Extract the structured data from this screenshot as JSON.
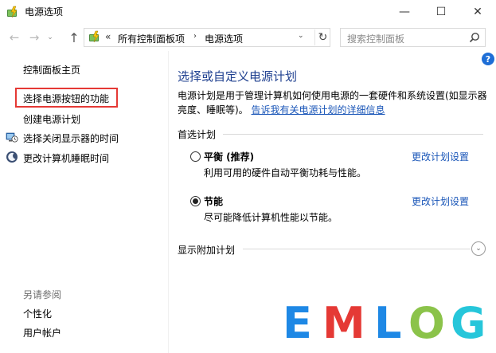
{
  "window": {
    "title": "电源选项",
    "minimize_symbol": "—",
    "maximize_symbol": "☐",
    "close_symbol": "✕"
  },
  "nav": {
    "back_symbol": "←",
    "forward_symbol": "→",
    "history_symbol": "⌄",
    "up_symbol": "↑",
    "overflow_symbol": "«",
    "breadcrumbs": [
      "所有控制面板项",
      "电源选项"
    ],
    "crumb_separator": "›",
    "address_drop_symbol": "⌄",
    "refresh_symbol": "↻",
    "search_placeholder": "搜索控制面板"
  },
  "help": {
    "label": "?"
  },
  "sidebar": {
    "home": "控制面板主页",
    "items": [
      {
        "label": "选择电源按钮的功能",
        "highlighted": true
      },
      {
        "label": "创建电源计划"
      },
      {
        "label": "选择关闭显示器的时间",
        "icon": "display-clock-icon"
      },
      {
        "label": "更改计算机睡眠时间",
        "icon": "moon-sleep-icon"
      }
    ],
    "see_also_title": "另请参阅",
    "see_also": [
      "个性化",
      "用户帐户"
    ]
  },
  "main": {
    "title": "选择或自定义电源计划",
    "description": "电源计划是用于管理计算机如何使用电源的一套硬件和系统设置(如显示器亮度、睡眠等)。",
    "description_link": "告诉我有关电源计划的详细信息",
    "section_title": "首选计划",
    "plans": [
      {
        "name": "平衡 (推荐)",
        "desc": "利用可用的硬件自动平衡功耗与性能。",
        "selected": false,
        "link": "更改计划设置"
      },
      {
        "name": "节能",
        "desc": "尽可能降低计算机性能以节能。",
        "selected": true,
        "link": "更改计划设置"
      }
    ],
    "more_plans": "显示附加计划",
    "more_toggle_symbol": "⌄"
  },
  "watermark": {
    "letters": [
      "E",
      "M",
      "L",
      "O",
      "G"
    ],
    "colors": [
      "#1e88e5",
      "#e53935",
      "#1e88e5",
      "#8bc34a",
      "#26c6da"
    ]
  },
  "colors": {
    "title_blue": "#1e3f8f",
    "link_blue": "#1a56b8",
    "highlight_red": "#e53935"
  }
}
